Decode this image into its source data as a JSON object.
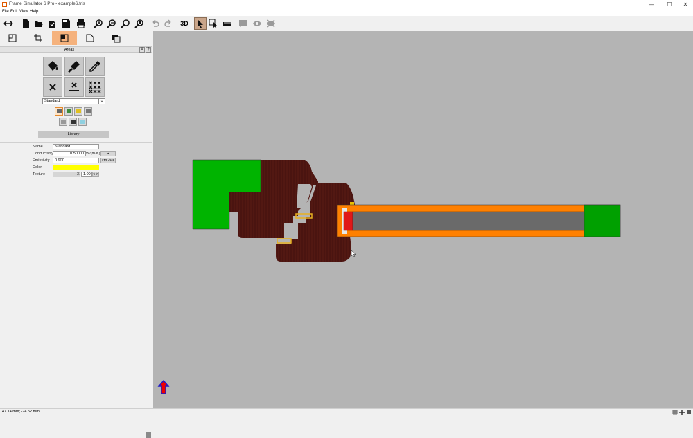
{
  "window": {
    "title": "Frame Simulator 6 Pro - example6.fris",
    "minimize": "—",
    "maximize": "☐",
    "close": "✕"
  },
  "menu": [
    "File",
    "Edit",
    "View",
    "Help"
  ],
  "toolbar": {
    "view_3d_label": "3D"
  },
  "panel": {
    "header_title": "Areas",
    "header_btn_a": "A",
    "header_btn_help": "?",
    "material_select": "Standard",
    "library_label": "Library",
    "properties": {
      "name_label": "Name",
      "name_value": "Standard",
      "conductivity_label": "Conductivity",
      "conductivity_value": "0.50000",
      "conductivity_unit": "W/(m·K)",
      "conductivity_btn": "R",
      "emissivity_label": "Emissivity",
      "emissivity_value": "0.900",
      "emissivity_btn": "εm -> ε",
      "color_label": "Color",
      "color_value": "#ffff00",
      "texture_label": "Texture",
      "texture_x": "X",
      "texture_scale": "1.00",
      "texture_btn": "< >"
    }
  },
  "colors": {
    "accent_tab": "#f5b27d",
    "canvas_bg": "#b4b4b4",
    "wood": "#4a1410",
    "insulation_green": "#00b400",
    "glazing_orange": "#ff8000",
    "glass_gray": "#6a6a6a",
    "spacer_red": "#e01818"
  },
  "status": {
    "coords": "47.14 mm; -24.52 mm"
  }
}
